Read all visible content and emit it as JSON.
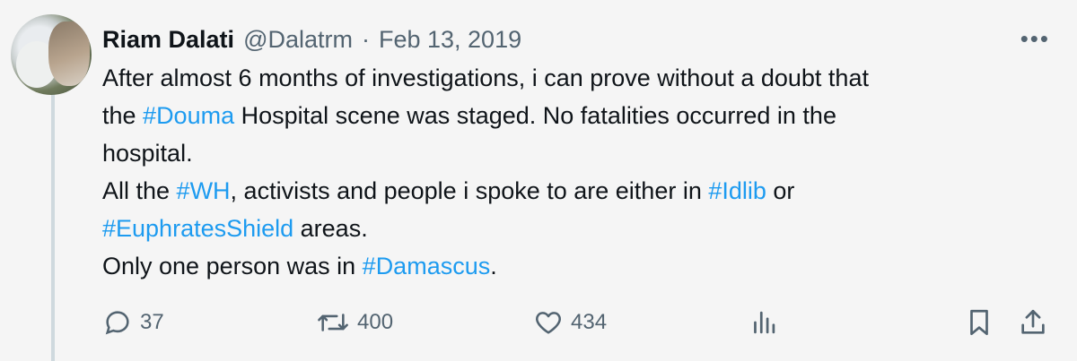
{
  "tweet": {
    "author_name": "Riam Dalati",
    "handle": "@Dalatrm",
    "separator": "·",
    "date": "Feb 13, 2019",
    "more_label": "•••",
    "lines": [
      [
        {
          "t": "After almost 6 months of investigations, i can prove without a doubt that"
        }
      ],
      [
        {
          "t": "the "
        },
        {
          "t": "#Douma",
          "tag": true
        },
        {
          "t": " Hospital scene was staged. No fatalities occurred in the"
        }
      ],
      [
        {
          "t": "hospital."
        }
      ],
      [
        {
          "t": "All the "
        },
        {
          "t": "#WH",
          "tag": true
        },
        {
          "t": ", activists and people i spoke to are either in "
        },
        {
          "t": "#Idlib",
          "tag": true
        },
        {
          "t": " or"
        }
      ],
      [
        {
          "t": "#EuphratesShield",
          "tag": true
        },
        {
          "t": " areas."
        }
      ],
      [
        {
          "t": "Only one person was in "
        },
        {
          "t": "#Damascus",
          "tag": true
        },
        {
          "t": "."
        }
      ]
    ]
  },
  "actions": {
    "reply_count": "37",
    "retweet_count": "400",
    "like_count": "434"
  },
  "colors": {
    "hashtag": "#1d9bf0",
    "secondary_text": "#536471"
  },
  "icons": [
    "reply-icon",
    "retweet-icon",
    "like-icon",
    "views-icon",
    "bookmark-icon",
    "share-icon",
    "more-icon"
  ]
}
